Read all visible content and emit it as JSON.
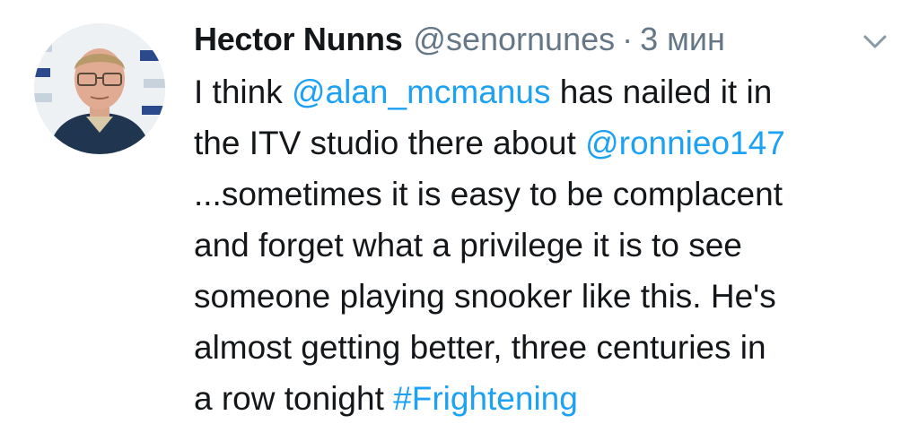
{
  "author": {
    "name": "Hector Nunns",
    "handle": "@senornunes",
    "separator": "·",
    "time": "3 мин"
  },
  "icons": {
    "avatar": "profile-photo",
    "menu": "chevron-down-icon"
  },
  "colors": {
    "link": "#1da1f2",
    "text": "#14171a",
    "muted": "#657786"
  },
  "tweet": {
    "lines": [
      {
        "t1": "I think ",
        "mention": "@alan_mcmanus",
        "t2": " has nailed it in"
      },
      {
        "t1": "the ITV studio there about ",
        "mention": "@ronnieo147"
      },
      {
        "t1": "...sometimes it is easy to be complacent"
      },
      {
        "t1": "and forget what a privilege it is to see"
      },
      {
        "t1": "someone playing snooker like this. He's"
      },
      {
        "t1": "almost getting better, three centuries in"
      },
      {
        "t1": "a row tonight ",
        "hashtag": "#Frightening"
      }
    ]
  }
}
